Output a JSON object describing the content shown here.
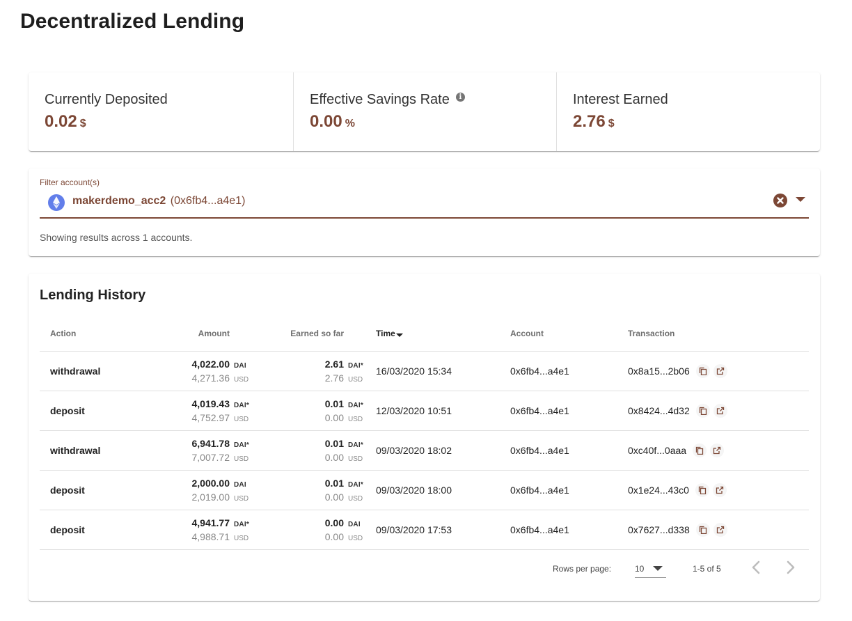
{
  "page": {
    "title": "Decentralized Lending"
  },
  "stats": [
    {
      "title": "Currently Deposited",
      "value": "0.02",
      "unit": "$"
    },
    {
      "title": "Effective Savings Rate",
      "value": "0.00",
      "unit": "%",
      "info_icon": "info-icon"
    },
    {
      "title": "Interest Earned",
      "value": "2.76",
      "unit": "$"
    }
  ],
  "filter": {
    "label": "Filter account(s)",
    "account_name": "makerdemo_acc2",
    "account_address": "(0x6fb4...a4e1)",
    "info": "Showing results across 1 accounts.",
    "icons": {
      "chain": "ethereum-icon",
      "clear": "clear-icon",
      "dropdown": "chevron-down-icon"
    }
  },
  "history": {
    "title": "Lending History",
    "columns": {
      "action": "Action",
      "amount": "Amount",
      "earned": "Earned so far",
      "time": "Time",
      "account": "Account",
      "transaction": "Transaction"
    },
    "rows": [
      {
        "action": "withdrawal",
        "amount": "4,022.00",
        "amount_unit": "DAI",
        "amount_usd": "4,271.36",
        "earned": "2.61",
        "earned_unit": "DAI*",
        "earned_usd": "2.76",
        "time": "16/03/2020 15:34",
        "account": "0x6fb4...a4e1",
        "tx": "0x8a15...2b06"
      },
      {
        "action": "deposit",
        "amount": "4,019.43",
        "amount_unit": "DAI*",
        "amount_usd": "4,752.97",
        "earned": "0.01",
        "earned_unit": "DAI*",
        "earned_usd": "0.00",
        "time": "12/03/2020 10:51",
        "account": "0x6fb4...a4e1",
        "tx": "0x8424...4d32"
      },
      {
        "action": "withdrawal",
        "amount": "6,941.78",
        "amount_unit": "DAI*",
        "amount_usd": "7,007.72",
        "earned": "0.01",
        "earned_unit": "DAI*",
        "earned_usd": "0.00",
        "time": "09/03/2020 18:02",
        "account": "0x6fb4...a4e1",
        "tx": "0xc40f...0aaa"
      },
      {
        "action": "deposit",
        "amount": "2,000.00",
        "amount_unit": "DAI",
        "amount_usd": "2,019.00",
        "earned": "0.01",
        "earned_unit": "DAI*",
        "earned_usd": "0.00",
        "time": "09/03/2020 18:00",
        "account": "0x6fb4...a4e1",
        "tx": "0x1e24...43c0"
      },
      {
        "action": "deposit",
        "amount": "4,941.77",
        "amount_unit": "DAI*",
        "amount_usd": "4,988.71",
        "earned": "0.00",
        "earned_unit": "DAI",
        "earned_usd": "0.00",
        "time": "09/03/2020 17:53",
        "account": "0x6fb4...a4e1",
        "tx": "0x7627...d338"
      }
    ],
    "usd_unit": "USD",
    "pagination": {
      "rows_per_page_label": "Rows per page:",
      "rows_per_page_value": "10",
      "range": "1-5 of 5"
    }
  },
  "colors": {
    "accent": "#7c4735",
    "ethereum": "#627eea"
  }
}
